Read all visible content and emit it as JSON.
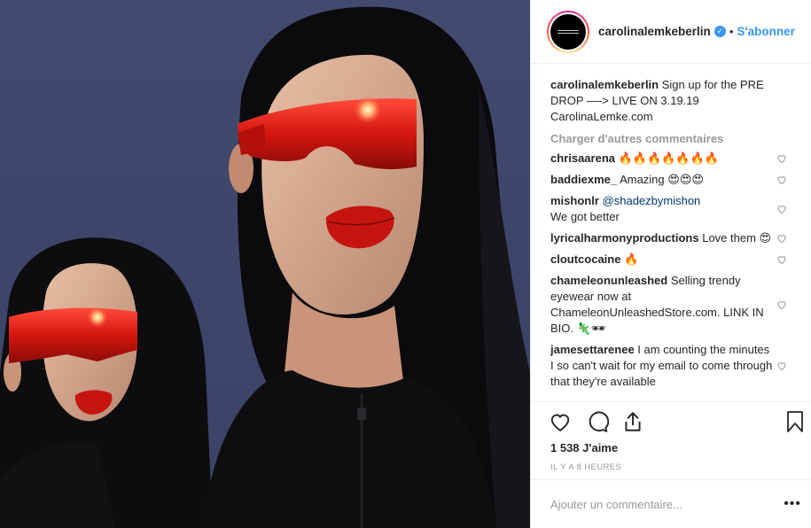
{
  "post": {
    "image_alt": "",
    "header": {
      "username": "carolinalemkeberlin",
      "verified": true,
      "separator": "•",
      "follow_label": "S'abonner"
    },
    "caption": {
      "username": "carolinalemkeberlin",
      "text": "Sign up for the PRE DROP —-> LIVE ON 3.19.19 CarolinaLemke.com"
    },
    "load_more_label": "Charger d'autres commentaires",
    "comments": [
      {
        "username": "chrisaarena",
        "text": "🔥🔥🔥🔥🔥🔥🔥"
      },
      {
        "username": "baddiexme_",
        "text": "Amazing 😍😍😍"
      },
      {
        "username": "mishonlr",
        "mention": "@shadezbymishon",
        "text": "We got better"
      },
      {
        "username": "lyricalharmonyproductions",
        "text": "Love them 😍"
      },
      {
        "username": "cloutcocaine",
        "text": "🔥"
      },
      {
        "username": "chameleonunleashed",
        "text": "Selling trendy eyewear now at ChameleonUnleashedStore.com. LINK IN BIO. 🦎🕶"
      },
      {
        "username": "jamesettarenee",
        "text": "I am counting the minutes I so can't wait for my email to come through that they're available"
      }
    ],
    "likes_text": "1 538 J'aime",
    "time_text": "IL Y A 8 HEURES",
    "add_comment_placeholder": "Ajouter un commentaire...",
    "more_label": "•••"
  },
  "icons": {
    "like": "heart-icon",
    "comment": "comment-icon",
    "share": "share-icon",
    "save": "bookmark-icon"
  },
  "colors": {
    "link_blue": "#3897f0",
    "text": "#262626",
    "muted": "#999999",
    "border": "#efefef"
  }
}
